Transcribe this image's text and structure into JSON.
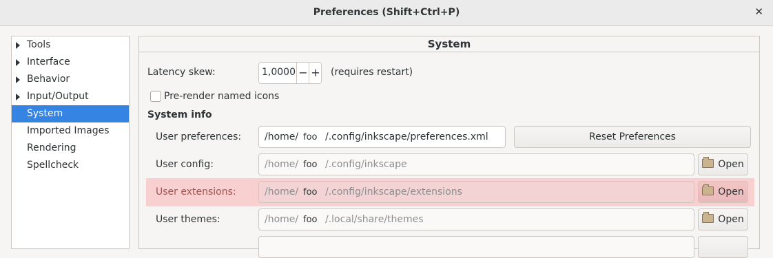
{
  "window": {
    "title": "Preferences (Shift+Ctrl+P)",
    "close_symbol": "✕"
  },
  "sidebar": {
    "items": [
      {
        "label": "Tools",
        "expandable": true
      },
      {
        "label": "Interface",
        "expandable": true
      },
      {
        "label": "Behavior",
        "expandable": true
      },
      {
        "label": "Input/Output",
        "expandable": true
      },
      {
        "label": "System",
        "expandable": false,
        "selected": true
      },
      {
        "label": "Imported Images",
        "expandable": false
      },
      {
        "label": "Rendering",
        "expandable": false
      },
      {
        "label": "Spellcheck",
        "expandable": false
      }
    ]
  },
  "panel": {
    "title": "System",
    "latency": {
      "label": "Latency skew:",
      "value": "1,0000",
      "minus": "−",
      "plus": "+",
      "note": "(requires restart)"
    },
    "prerender": {
      "label": "Pre-render named icons",
      "checked": false
    },
    "system_info_heading": "System info",
    "rows": {
      "user_prefs": {
        "label": "User preferences:",
        "prefix": "/home/",
        "user": "foo",
        "suffix": "/.config/inkscape/preferences.xml",
        "button": "Reset Preferences"
      },
      "user_config": {
        "label": "User config:",
        "prefix": "/home/",
        "user": "foo",
        "suffix": "/.config/inkscape",
        "button": "Open"
      },
      "user_extensions": {
        "label": "User extensions:",
        "prefix": "/home/",
        "user": "foo",
        "suffix": "/.config/inkscape/extensions",
        "button": "Open"
      },
      "user_themes": {
        "label": "User themes:",
        "prefix": "/home/",
        "user": "foo",
        "suffix": "/.local/share/themes",
        "button": "Open"
      }
    }
  },
  "colors": {
    "selection": "#3584e4",
    "highlight_row": "#f8d0d0"
  }
}
